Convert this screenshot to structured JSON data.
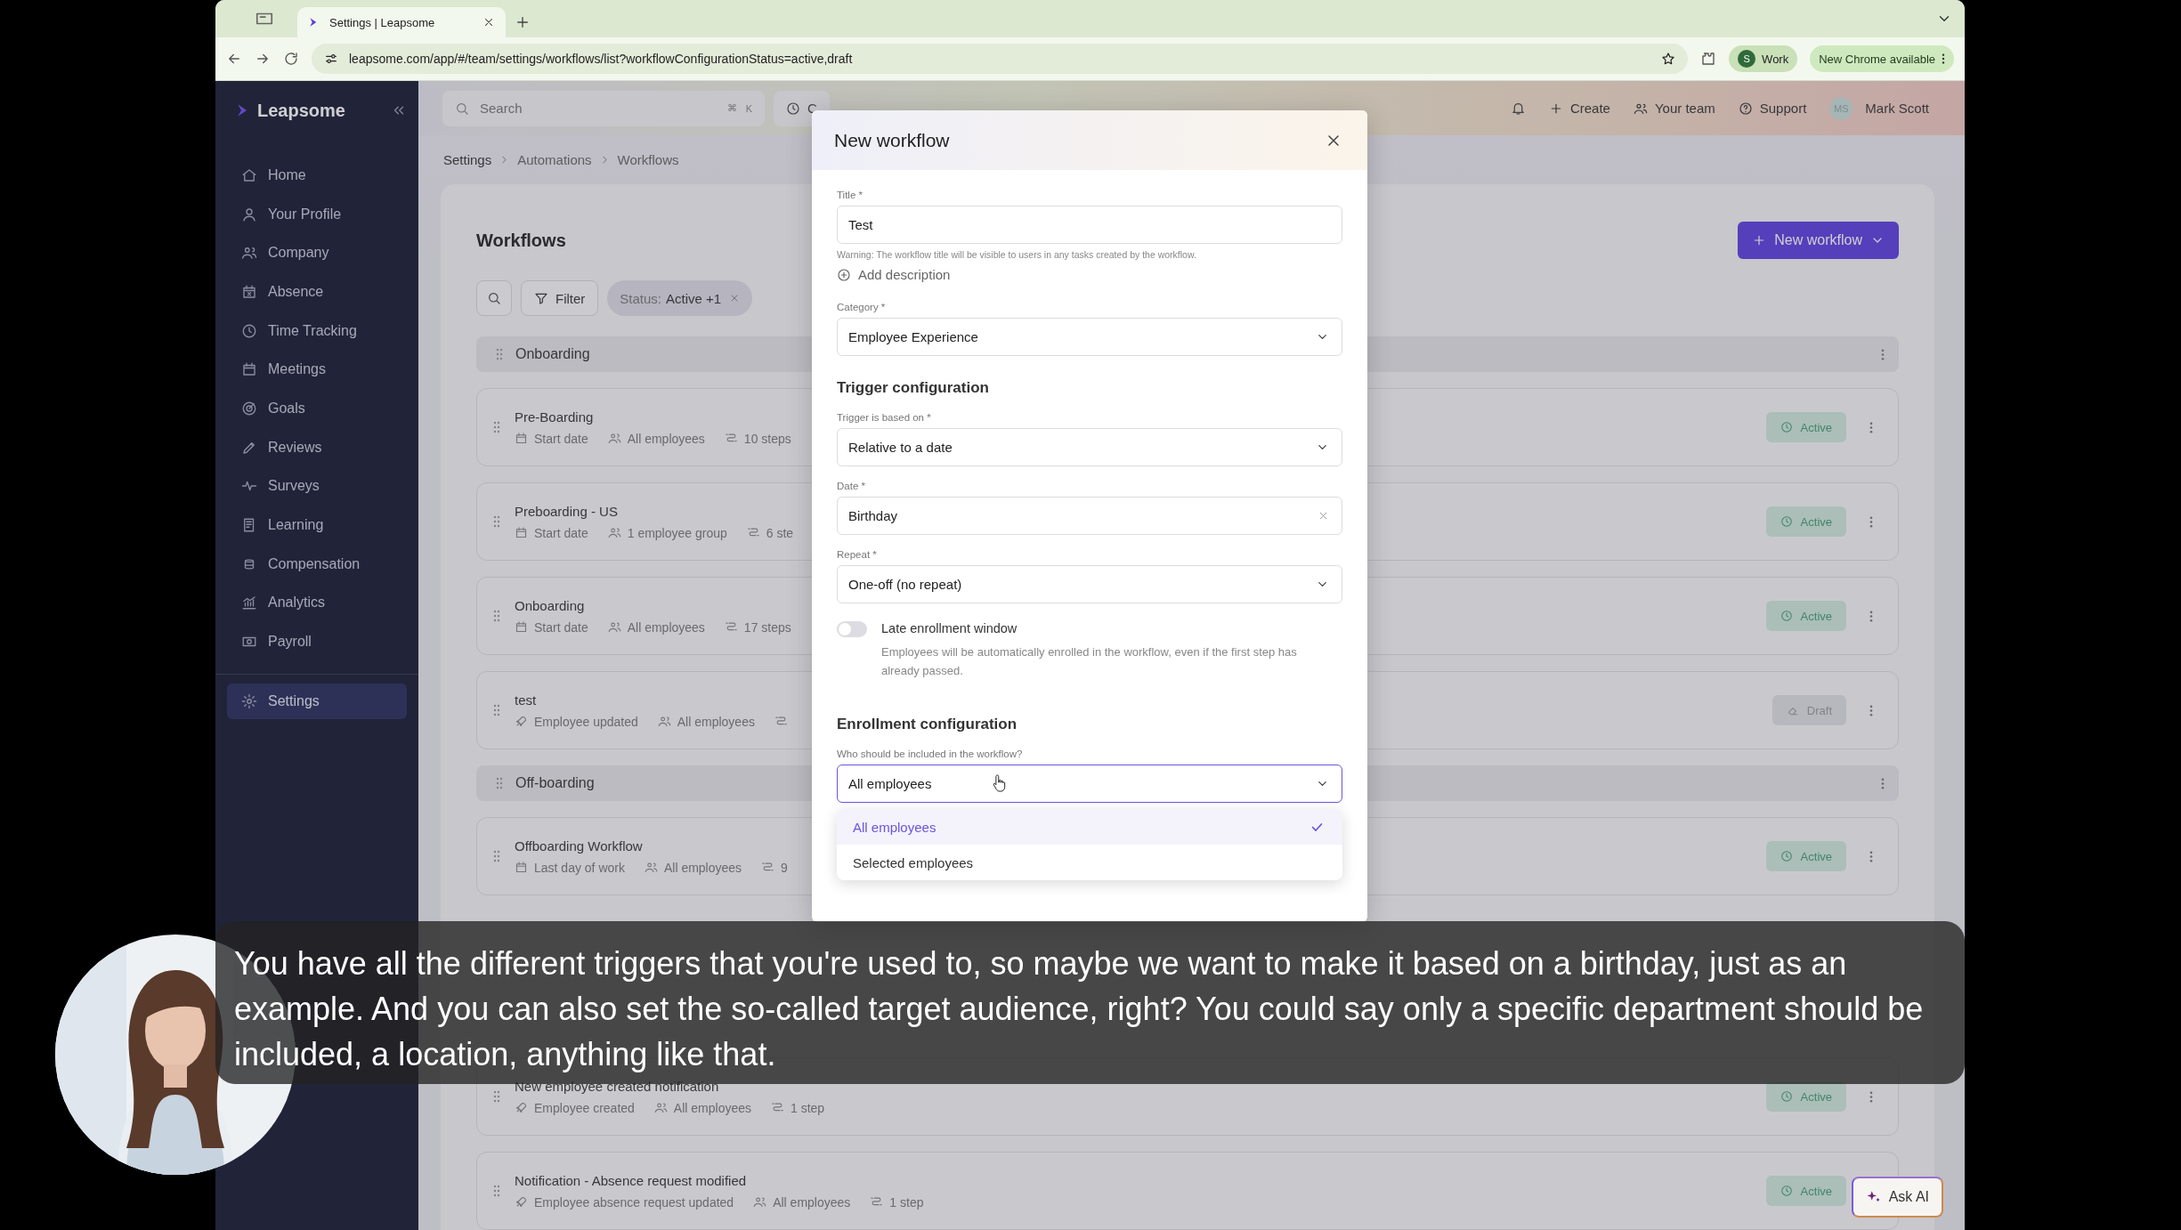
{
  "browser": {
    "tab": {
      "title": "Settings | Leapsome"
    },
    "url": "leapsome.com/app/#/team/settings/workflows/list?workflowConfigurationStatus=active,draft",
    "profile": {
      "initial": "S",
      "label": "Work"
    },
    "update_label": "New Chrome available"
  },
  "sidebar": {
    "brand": "Leapsome",
    "items": [
      {
        "label": "Home",
        "selected": false
      },
      {
        "label": "Your Profile",
        "selected": false
      },
      {
        "label": "Company",
        "selected": false
      },
      {
        "label": "Absence",
        "selected": false
      },
      {
        "label": "Time Tracking",
        "selected": false
      },
      {
        "label": "Meetings",
        "selected": false
      },
      {
        "label": "Goals",
        "selected": false
      },
      {
        "label": "Reviews",
        "selected": false
      },
      {
        "label": "Surveys",
        "selected": false
      },
      {
        "label": "Learning",
        "selected": false
      },
      {
        "label": "Compensation",
        "selected": false
      },
      {
        "label": "Analytics",
        "selected": false
      },
      {
        "label": "Payroll",
        "selected": false
      }
    ],
    "bottom_items": [
      {
        "label": "Settings",
        "selected": true
      }
    ]
  },
  "header": {
    "search": {
      "placeholder": "Search",
      "shortcut": [
        "⌘",
        "K"
      ]
    },
    "recent_label": "C",
    "actions": [
      {
        "label": "Create"
      },
      {
        "label": "Your team"
      },
      {
        "label": "Support"
      }
    ],
    "user": {
      "initials": "MS",
      "name": "Mark Scott"
    }
  },
  "breadcrumb": [
    "Settings",
    "Automations",
    "Workflows"
  ],
  "workflows": {
    "title": "Workflows",
    "new_button": "New workflow",
    "filter_label": "Filter",
    "status_chip": {
      "label": "Status:",
      "value": "Active +1"
    },
    "groups": [
      {
        "name": "Onboarding",
        "items": [
          {
            "title": "Pre-Boarding",
            "meta": [
              {
                "kind": "date",
                "text": "Start date"
              },
              {
                "kind": "audience",
                "text": "All employees"
              },
              {
                "kind": "steps",
                "text": "10 steps"
              }
            ],
            "status": {
              "kind": "active",
              "label": "Active"
            }
          },
          {
            "title": "Preboarding - US",
            "meta": [
              {
                "kind": "date",
                "text": "Start date"
              },
              {
                "kind": "audience",
                "text": "1 employee group"
              },
              {
                "kind": "steps",
                "text": "6 ste"
              }
            ],
            "status": {
              "kind": "active",
              "label": "Active"
            }
          },
          {
            "title": "Onboarding",
            "meta": [
              {
                "kind": "date",
                "text": "Start date"
              },
              {
                "kind": "audience",
                "text": "All employees"
              },
              {
                "kind": "steps",
                "text": "17 steps"
              }
            ],
            "status": {
              "kind": "active",
              "label": "Active"
            }
          },
          {
            "title": "test",
            "meta": [
              {
                "kind": "event",
                "text": "Employee updated"
              },
              {
                "kind": "audience",
                "text": "All employees"
              },
              {
                "kind": "steps"
              }
            ],
            "status": {
              "kind": "draft",
              "label": "Draft"
            }
          }
        ]
      },
      {
        "name": "Off-boarding",
        "items": [
          {
            "title": "Offboarding Workflow",
            "meta": [
              {
                "kind": "date",
                "text": "Last day of work"
              },
              {
                "kind": "audience",
                "text": "All employees"
              },
              {
                "kind": "steps",
                "text": "9"
              }
            ],
            "status": {
              "kind": "active",
              "label": "Active"
            }
          }
        ]
      },
      {
        "items": [
          {
            "title": "New employee created notification",
            "meta": [
              {
                "kind": "event",
                "text": "Employee created"
              },
              {
                "kind": "audience",
                "text": "All employees"
              },
              {
                "kind": "steps",
                "text": "1 step"
              }
            ],
            "status": {
              "kind": "active",
              "label": "Active"
            }
          },
          {
            "title": "Notification - Absence request modified",
            "meta": [
              {
                "kind": "event",
                "text": "Employee absence request updated"
              },
              {
                "kind": "audience",
                "text": "All employees"
              },
              {
                "kind": "steps",
                "text": "1 step"
              }
            ],
            "status": {
              "kind": "active",
              "label": "Active"
            }
          }
        ]
      }
    ]
  },
  "modal": {
    "title": "New workflow",
    "title_field": {
      "label": "Title *",
      "value": "Test",
      "warning": "Warning: The workflow title will be visible to users in any tasks created by the workflow."
    },
    "add_description": "Add description",
    "category": {
      "label": "Category *",
      "value": "Employee Experience"
    },
    "trigger": {
      "heading": "Trigger configuration",
      "fields": [
        {
          "kind": "select",
          "label": "Trigger is based on *",
          "value": "Relative to a date"
        },
        {
          "kind": "clearable",
          "label": "Date *",
          "value": "Birthday"
        },
        {
          "kind": "select",
          "label": "Repeat *",
          "value": "One-off (no repeat)"
        }
      ],
      "late_enrollment": {
        "on": false,
        "label": "Late enrollment window",
        "description": "Employees will be automatically enrolled in the workflow, even if the first step has already passed."
      }
    },
    "enrollment": {
      "heading": "Enrollment configuration",
      "label": "Who should be included in the workflow?",
      "value": "All employees",
      "expanded": true,
      "options": [
        {
          "label": "All employees",
          "selected": true
        },
        {
          "label": "Selected employees",
          "selected": false
        }
      ]
    }
  },
  "subtitle": "You have all the different triggers that you're used to, so maybe we want to make it based on a birthday, just as an example. And you can also set the so-called target audience, right? You could say only a specific department should be included, a location, anything like that.",
  "ask_ai": "Ask AI"
}
